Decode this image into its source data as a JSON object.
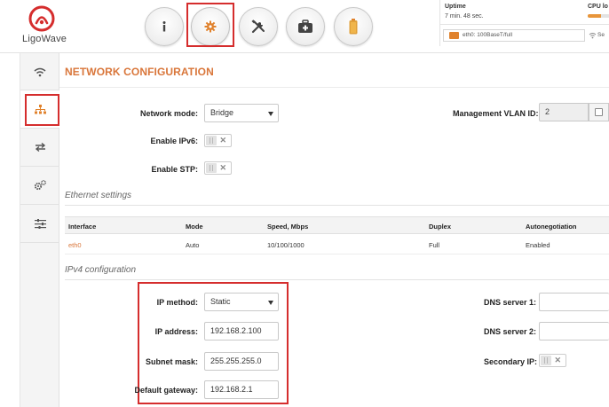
{
  "brand": {
    "name": "LigoWave",
    "accent": "#d9763a",
    "highlight": "#d52d2d"
  },
  "top_nav": [
    {
      "id": "info",
      "icon": "info-icon"
    },
    {
      "id": "settings",
      "icon": "gear-icon",
      "active": true
    },
    {
      "id": "tools",
      "icon": "tools-icon"
    },
    {
      "id": "services",
      "icon": "medical-kit-icon"
    },
    {
      "id": "battery",
      "icon": "battery-icon"
    }
  ],
  "status": {
    "uptime_label": "Uptime",
    "uptime_value": "7 min. 48 sec.",
    "cpu_label": "CPU lo",
    "cpu_fraction": 0.6,
    "eth_text": "eth0: 100BaseT/full",
    "wifi_text": "Se"
  },
  "sidebar": [
    {
      "id": "wireless",
      "icon": "wifi-icon"
    },
    {
      "id": "network",
      "icon": "network-tree-icon",
      "active": true
    },
    {
      "id": "routing",
      "icon": "arrows-icon"
    },
    {
      "id": "services",
      "icon": "cogs-icon"
    },
    {
      "id": "system",
      "icon": "sliders-icon"
    }
  ],
  "page": {
    "title": "NETWORK CONFIGURATION",
    "network_mode": {
      "label": "Network mode:",
      "value": "Bridge"
    },
    "enable_ipv6": {
      "label": "Enable IPv6:"
    },
    "enable_stp": {
      "label": "Enable STP:"
    },
    "management_vlan": {
      "label": "Management VLAN ID:",
      "value": "2"
    }
  },
  "ethernet": {
    "title": "Ethernet settings",
    "headers": [
      "Interface",
      "Mode",
      "Speed, Mbps",
      "Duplex",
      "Autonegotiation"
    ],
    "rows": [
      [
        "eth0",
        "Auto",
        "10/100/1000",
        "Full",
        "Enabled"
      ]
    ]
  },
  "ipv4": {
    "title": "IPv4 configuration",
    "ip_method": {
      "label": "IP method:",
      "value": "Static"
    },
    "ip_address": {
      "label": "IP address:",
      "value": "192.168.2.100"
    },
    "subnet_mask": {
      "label": "Subnet mask:",
      "value": "255.255.255.0"
    },
    "default_gateway": {
      "label": "Default gateway:",
      "value": "192.168.2.1"
    },
    "dns1": {
      "label": "DNS server 1:",
      "value": ""
    },
    "dns2": {
      "label": "DNS server 2:",
      "value": ""
    },
    "secondary_ip": {
      "label": "Secondary IP:"
    }
  }
}
